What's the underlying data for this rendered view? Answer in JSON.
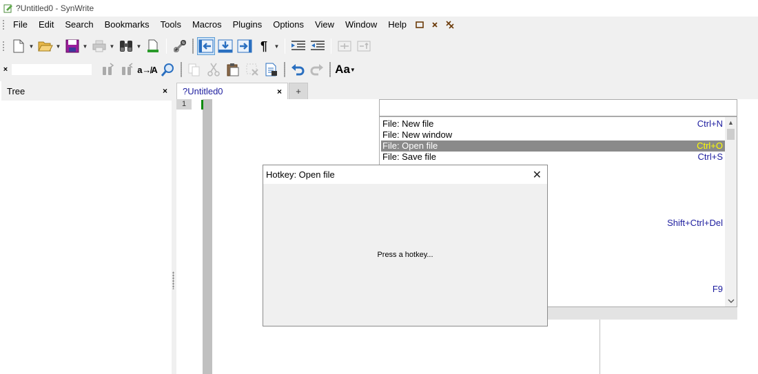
{
  "window": {
    "title": "?Untitled0 - SynWrite"
  },
  "menu": [
    "File",
    "Edit",
    "Search",
    "Bookmarks",
    "Tools",
    "Macros",
    "Plugins",
    "Options",
    "View",
    "Window",
    "Help"
  ],
  "menu_icons": [
    "restore-icon",
    "close-document-icon",
    "close-all-icon"
  ],
  "toolbar1": [
    "new-file-icon",
    "open-file-icon",
    "save-file-icon",
    "print-icon",
    "find-icon",
    "export-icon",
    "settings-tools-icon",
    "align-left-icon",
    "download-icon",
    "goto-icon",
    "pilcrow-icon",
    "indent-icon",
    "unindent-icon",
    "fold-icon",
    "unfold-icon"
  ],
  "toolbar2": [
    "find-prev-icon",
    "find-next-icon",
    "replace-icon",
    "zoom-find-icon",
    "copy-icon",
    "cut-icon",
    "paste-icon",
    "delete-icon",
    "select-icon",
    "undo-icon",
    "redo-icon",
    "font-icon"
  ],
  "search": {
    "close": "×",
    "value": ""
  },
  "tree": {
    "title": "Tree",
    "close": "×"
  },
  "tabs": {
    "active": "?Untitled0",
    "close": "×",
    "add": "+"
  },
  "editor": {
    "line_number": "1"
  },
  "command_palette": {
    "items": [
      {
        "label": "File: New file",
        "key": "Ctrl+N"
      },
      {
        "label": "File: New window",
        "key": ""
      },
      {
        "label": "File: Open file",
        "key": "Ctrl+O",
        "selected": true
      },
      {
        "label": "File: Save file",
        "key": "Ctrl+S"
      }
    ],
    "partial_key_1": "Shift+Ctrl+Del",
    "partial_key_2": "F9"
  },
  "dialog": {
    "title": "Hotkey: Open file",
    "close": "✕",
    "message": "Press a hotkey..."
  }
}
